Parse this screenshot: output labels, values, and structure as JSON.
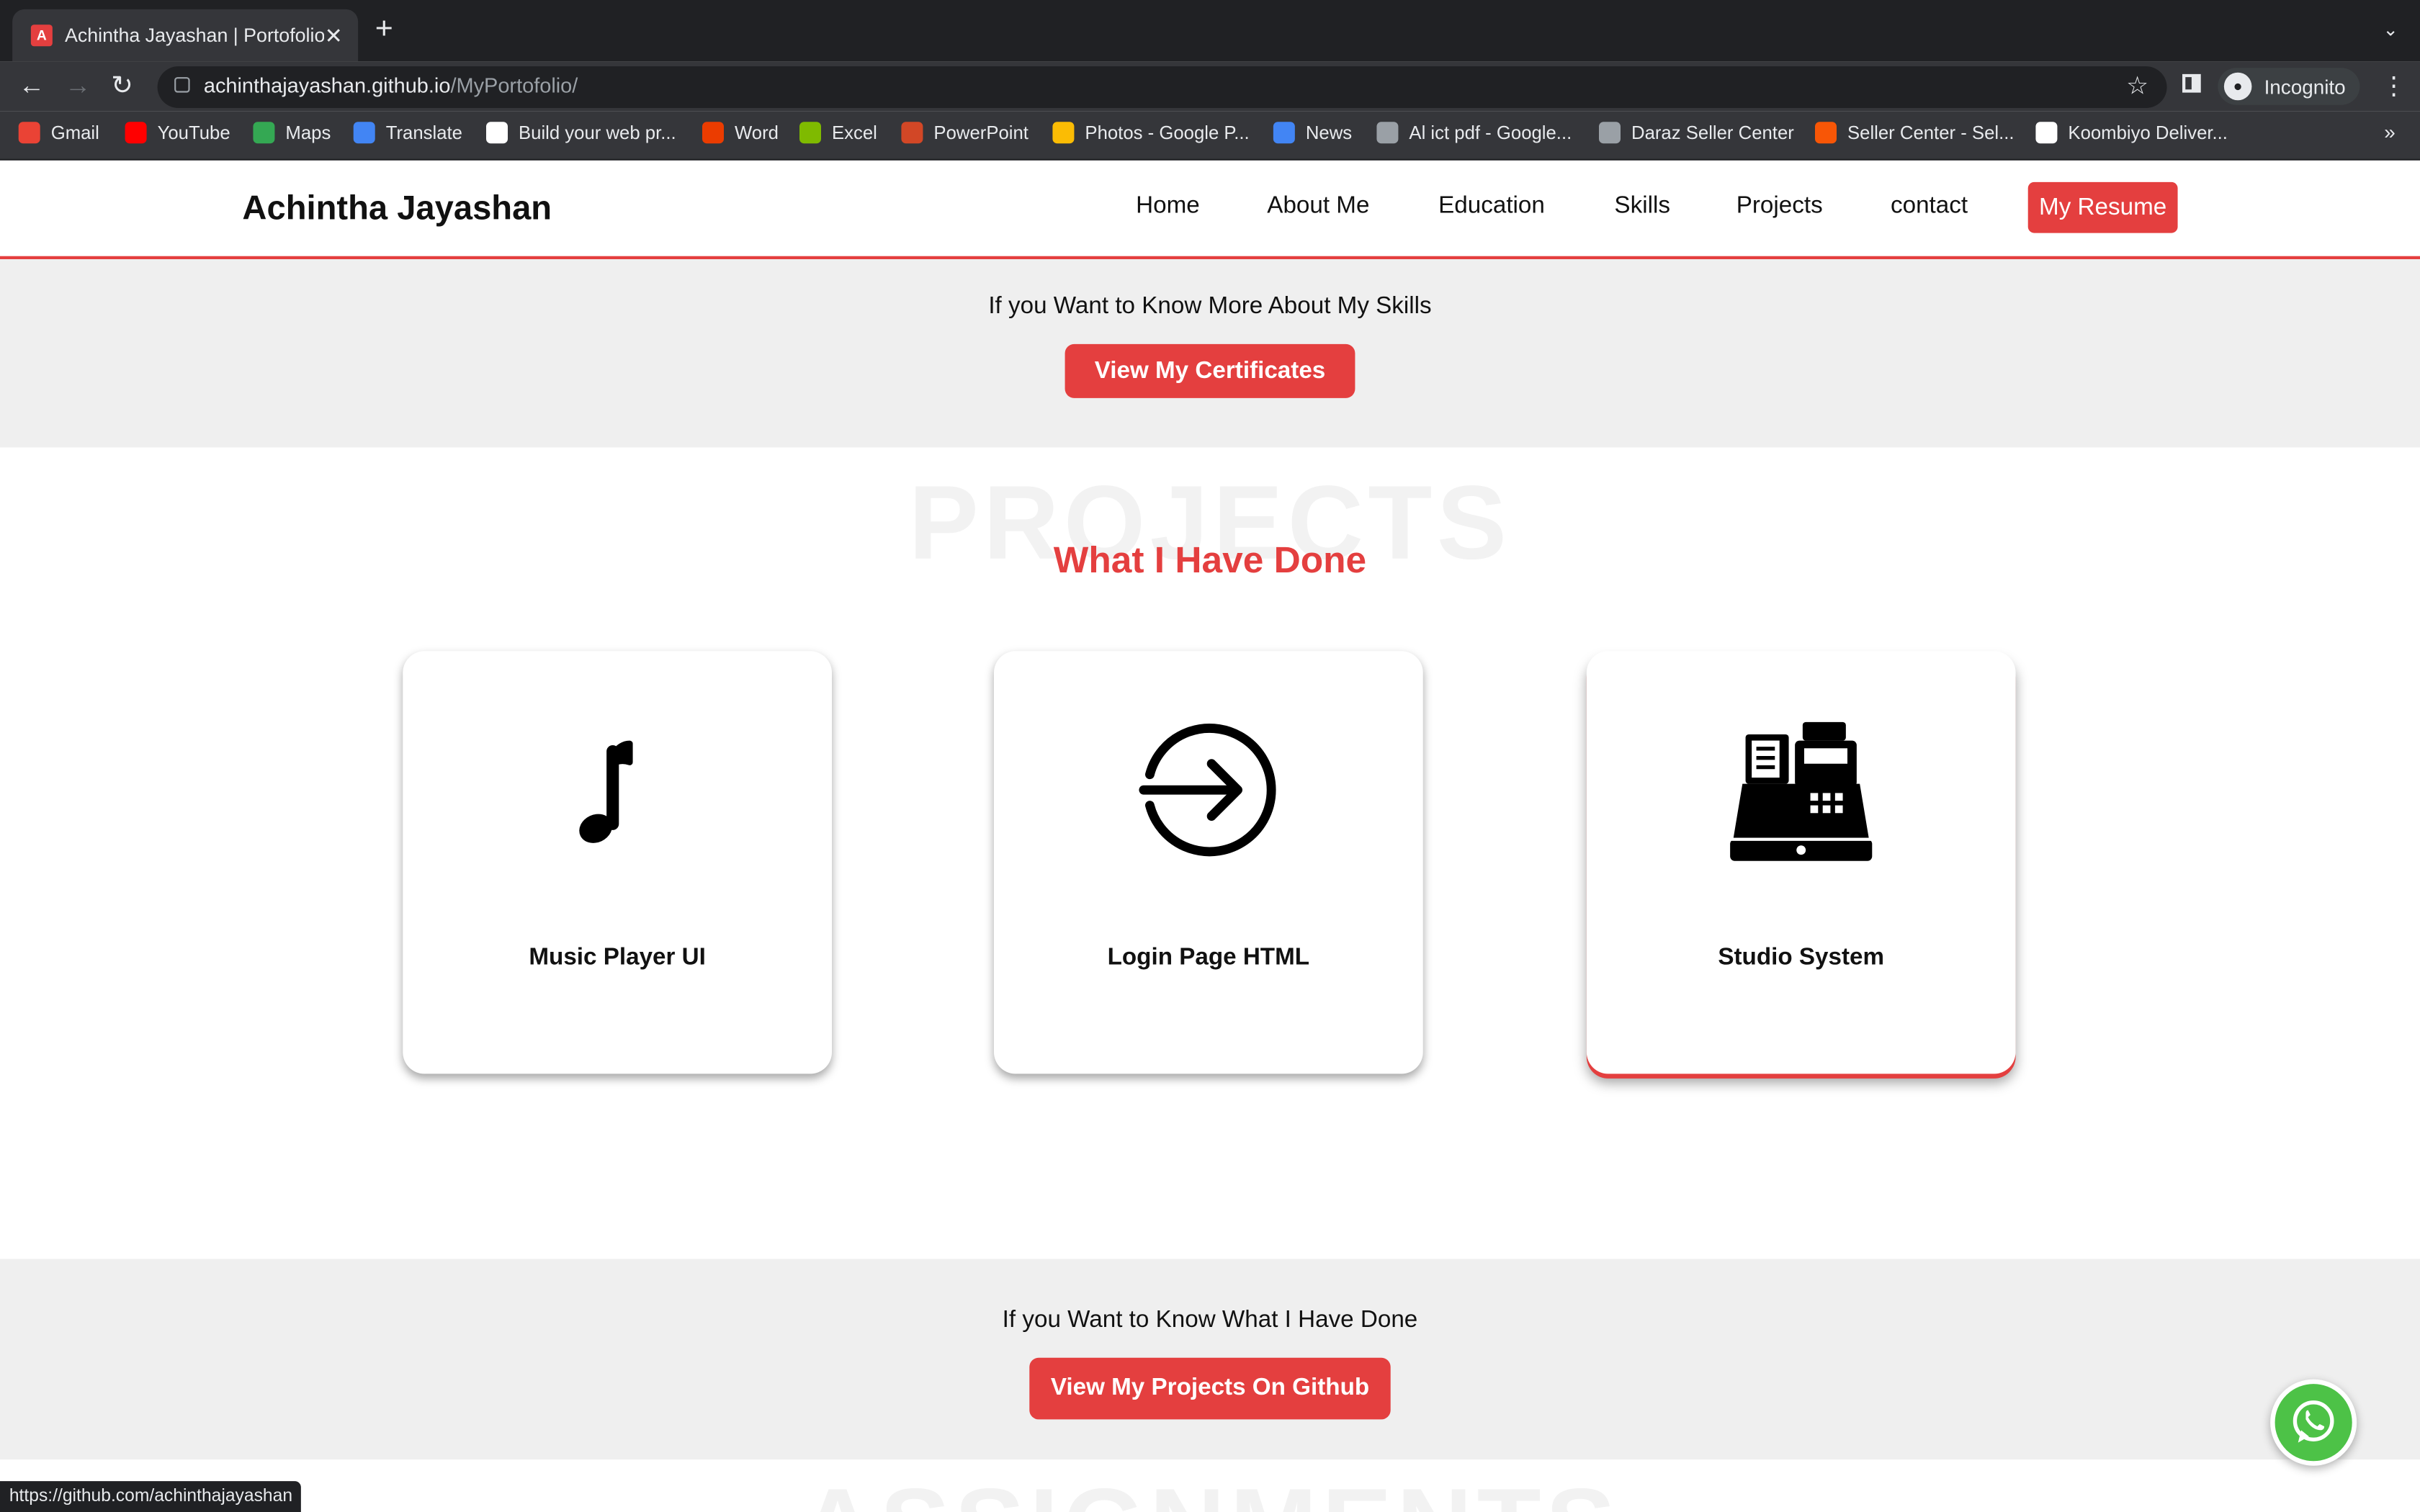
{
  "browser": {
    "tab_title": "Achintha Jayashan | Portofolio",
    "new_tab_symbol": "+",
    "url_host": "achinthajayashan.github.io",
    "url_path": "/MyPortofolio/",
    "profile_label": "Incognito",
    "status_url": "https://github.com/achinthajayashan"
  },
  "bookmarks": [
    {
      "label": "Gmail",
      "icon": "gmail-icon",
      "color": "#ea4335"
    },
    {
      "label": "YouTube",
      "icon": "youtube-icon",
      "color": "#ff0000"
    },
    {
      "label": "Maps",
      "icon": "maps-icon",
      "color": "#34a853"
    },
    {
      "label": "Translate",
      "icon": "translate-icon",
      "color": "#4285f4"
    },
    {
      "label": "Build your web pr...",
      "icon": "google-icon",
      "color": "#ffffff"
    },
    {
      "label": "Word",
      "icon": "office-icon",
      "color": "#eb3c00"
    },
    {
      "label": "Excel",
      "icon": "microsoft-icon",
      "color": "#7fba00"
    },
    {
      "label": "PowerPoint",
      "icon": "powerpoint-icon",
      "color": "#d24726"
    },
    {
      "label": "Photos - Google P...",
      "icon": "photos-icon",
      "color": "#fbbc04"
    },
    {
      "label": "News",
      "icon": "news-icon",
      "color": "#4285f4"
    },
    {
      "label": "Al ict pdf - Google...",
      "icon": "globe-icon",
      "color": "#9aa0a6"
    },
    {
      "label": "Daraz Seller Center",
      "icon": "globe-icon",
      "color": "#9aa0a6"
    },
    {
      "label": "Seller Center - Sel...",
      "icon": "daraz-icon",
      "color": "#f85606"
    },
    {
      "label": "Koombiyo Deliver...",
      "icon": "koombiyo-icon",
      "color": "#ffffff"
    }
  ],
  "site": {
    "brand": "Achintha Jayashan",
    "menu": [
      "Home",
      "About Me",
      "Education",
      "Skills",
      "Projects",
      "contact"
    ],
    "resume_button": "My Resume",
    "skills_prompt": "If you Want to Know More About My Skills",
    "certificates_button": "View My Certificates",
    "projects_bg_word": "PROJECTS",
    "projects_title": "What I Have Done",
    "projects": [
      {
        "label": "Music Player UI",
        "icon": "music-note-icon"
      },
      {
        "label": "Login Page HTML",
        "icon": "sign-in-arrow-icon"
      },
      {
        "label": "Studio System",
        "icon": "cash-register-icon"
      }
    ],
    "projects_prompt": "If you Want to Know What I Have Done",
    "github_button": "View My Projects On Github",
    "assignments_bg_word": "ASSIGNMENTS"
  },
  "colors": {
    "accent": "#e43f3f",
    "band": "#efefef",
    "whatsapp": "#4dc247"
  }
}
